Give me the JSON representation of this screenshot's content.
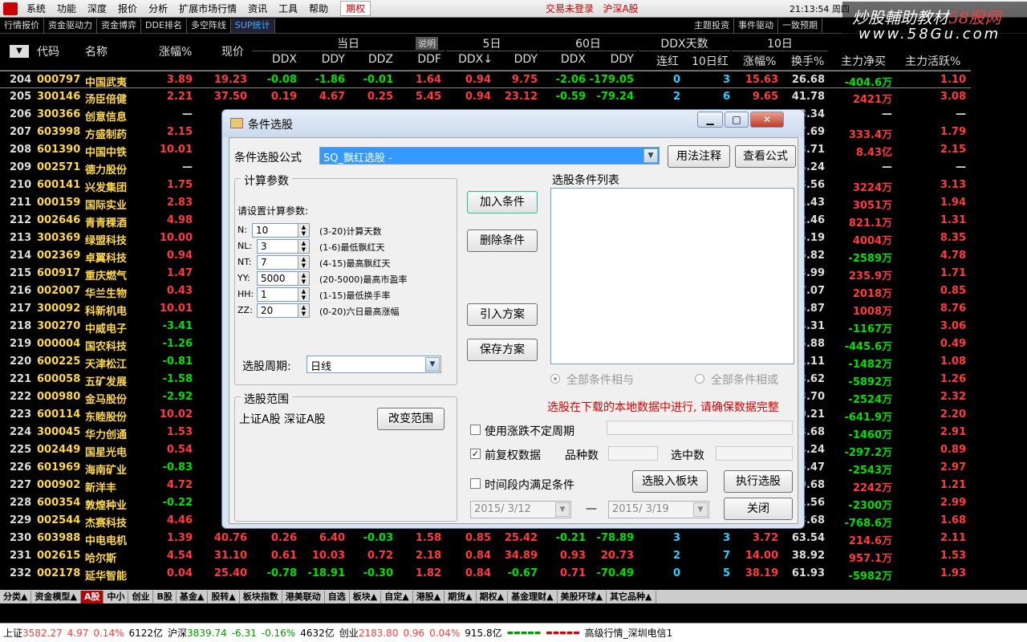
{
  "menu": {
    "items": [
      "系统",
      "功能",
      "深度",
      "报价",
      "分析",
      "扩展市场行情",
      "资讯",
      "工具",
      "帮助"
    ],
    "qiquan": "期权",
    "login": "交易未登录",
    "market": "沪深A股",
    "clock": "21:13:54 周四"
  },
  "tabs": {
    "left": [
      "行情报价",
      "资金驱动力",
      "资金博弈",
      "DDE排名",
      "多空阵线",
      "SUP统计"
    ],
    "active": "SUP统计",
    "right": [
      "主题投资",
      "事件驱动",
      "一致预期"
    ]
  },
  "watermark": {
    "line1a": "炒股輔助教材",
    "line1b": "58股网",
    "line2": "www.58Gu.com"
  },
  "table": {
    "groups": [
      "当日",
      "5日",
      "60日",
      "DDX天数",
      "10日"
    ],
    "shuoming": "说明",
    "headers": [
      "代码",
      "名称",
      "涨幅%",
      "现价",
      "DDX",
      "DDY",
      "DDZ",
      "DDF",
      "DDX↓",
      "DDY",
      "DDX",
      "DDY",
      "连红",
      "10日红",
      "涨幅%",
      "换手%",
      "主力净买",
      "主力活跃%"
    ],
    "rows": [
      [
        "204",
        "000797",
        "中国武夷",
        "3.89",
        "19.23",
        "-0.08",
        "-1.86",
        "-0.01",
        "1.64",
        "0.94",
        "9.75",
        "-2.06",
        "-179.05",
        "0",
        "3",
        "15.63",
        "26.68",
        "-404.6万",
        "1.10"
      ],
      [
        "205",
        "300146",
        "汤臣倍健",
        "2.21",
        "37.50",
        "0.19",
        "4.67",
        "0.25",
        "5.45",
        "0.94",
        "23.12",
        "-0.59",
        "-79.24",
        "2",
        "6",
        "9.65",
        "41.78",
        "2421万",
        "3.08"
      ],
      [
        "206",
        "300366",
        "创意信息",
        "—",
        "",
        "",
        "",
        "",
        "",
        "",
        "",
        "",
        "",
        "",
        "",
        "",
        "3.34",
        "—",
        "—"
      ],
      [
        "207",
        "603998",
        "方盛制药",
        "2.15",
        "",
        "",
        "",
        "",
        "",
        "",
        "",
        "",
        "",
        "",
        "",
        "",
        "7.69",
        "333.4万",
        "1.79"
      ],
      [
        "208",
        "601390",
        "中国中铁",
        "10.01",
        "",
        "",
        "",
        "",
        "",
        "",
        "",
        "",
        "",
        "",
        "",
        "",
        "3.71",
        "8.43亿",
        "2.15"
      ],
      [
        "209",
        "002571",
        "德力股份",
        "—",
        "",
        "",
        "",
        "",
        "",
        "",
        "",
        "",
        "",
        "",
        "",
        "",
        "4.24",
        "—",
        "—"
      ],
      [
        "210",
        "600141",
        "兴发集团",
        "1.75",
        "",
        "",
        "",
        "",
        "",
        "",
        "",
        "",
        "",
        "",
        "",
        "",
        "3.56",
        "3224万",
        "3.13"
      ],
      [
        "211",
        "000159",
        "国际实业",
        "2.83",
        "",
        "",
        "",
        "",
        "",
        "",
        "",
        "",
        "",
        "",
        "",
        "",
        "1.43",
        "3051万",
        "1.94"
      ],
      [
        "212",
        "002646",
        "青青稞酒",
        "4.98",
        "",
        "",
        "",
        "",
        "",
        "",
        "",
        "",
        "",
        "",
        "",
        "",
        "2.46",
        "821.1万",
        "1.31"
      ],
      [
        "213",
        "300369",
        "绿盟科技",
        "10.00",
        "",
        "",
        "",
        "",
        "",
        "",
        "",
        "",
        "",
        "",
        "",
        "",
        "5.19",
        "4004万",
        "8.35"
      ],
      [
        "214",
        "002369",
        "卓翼科技",
        "0.94",
        "",
        "",
        "",
        "",
        "",
        "",
        "",
        "",
        "",
        "",
        "",
        "",
        "6.82",
        "-2589万",
        "4.78"
      ],
      [
        "215",
        "600917",
        "重庆燃气",
        "1.47",
        "",
        "",
        "",
        "",
        "",
        "",
        "",
        "",
        "",
        "",
        "",
        "",
        "3.99",
        "235.9万",
        "1.71"
      ],
      [
        "216",
        "002007",
        "华兰生物",
        "0.43",
        "",
        "",
        "",
        "",
        "",
        "",
        "",
        "",
        "",
        "",
        "",
        "",
        "7.07",
        "2018万",
        "0.85"
      ],
      [
        "217",
        "300092",
        "科新机电",
        "10.01",
        "",
        "",
        "",
        "",
        "",
        "",
        "",
        "",
        "",
        "",
        "",
        "",
        "5.87",
        "1008万",
        "8.76"
      ],
      [
        "218",
        "300270",
        "中威电子",
        "-3.41",
        "",
        "",
        "",
        "",
        "",
        "",
        "",
        "",
        "",
        "",
        "",
        "",
        "4.31",
        "-1167万",
        "3.06"
      ],
      [
        "219",
        "000004",
        "国农科技",
        "-1.26",
        "",
        "",
        "",
        "",
        "",
        "",
        "",
        "",
        "",
        "",
        "",
        "",
        "5.88",
        "-445.6万",
        "0.49"
      ],
      [
        "220",
        "600225",
        "天津松江",
        "-0.81",
        "",
        "",
        "",
        "",
        "",
        "",
        "",
        "",
        "",
        "",
        "",
        "",
        "1.11",
        "-1482万",
        "1.08"
      ],
      [
        "221",
        "600058",
        "五矿发展",
        "-1.58",
        "",
        "",
        "",
        "",
        "",
        "",
        "",
        "",
        "",
        "",
        "",
        "",
        "3.62",
        "-5892万",
        "1.26"
      ],
      [
        "222",
        "000980",
        "金马股份",
        "-2.92",
        "",
        "",
        "",
        "",
        "",
        "",
        "",
        "",
        "",
        "",
        "",
        "",
        "3.70",
        "-2524万",
        "2.32"
      ],
      [
        "223",
        "600114",
        "东睦股份",
        "10.02",
        "",
        "",
        "",
        "",
        "",
        "",
        "",
        "",
        "",
        "",
        "",
        "",
        "0.21",
        "-641.9万",
        "2.20"
      ],
      [
        "224",
        "300045",
        "华力创通",
        "1.53",
        "",
        "",
        "",
        "",
        "",
        "",
        "",
        "",
        "",
        "",
        "",
        "",
        "3.68",
        "-1460万",
        "2.91"
      ],
      [
        "225",
        "002449",
        "国星光电",
        "0.54",
        "",
        "",
        "",
        "",
        "",
        "",
        "",
        "",
        "",
        "",
        "",
        "",
        "4.24",
        "-297.2万",
        "0.89"
      ],
      [
        "226",
        "601969",
        "海南矿业",
        "-0.83",
        "",
        "",
        "",
        "",
        "",
        "",
        "",
        "",
        "",
        "",
        "",
        "",
        "5.47",
        "-2543万",
        "2.97"
      ],
      [
        "227",
        "000902",
        "新洋丰",
        "4.72",
        "",
        "",
        "",
        "",
        "",
        "",
        "",
        "",
        "",
        "",
        "",
        "",
        "0.68",
        "2242万",
        "1.21"
      ],
      [
        "228",
        "600354",
        "敦煌种业",
        "-0.22",
        "",
        "",
        "",
        "",
        "",
        "",
        "",
        "",
        "",
        "",
        "",
        "",
        "1.56",
        "-2300万",
        "2.99"
      ],
      [
        "229",
        "002544",
        "杰赛科技",
        "4.46",
        "",
        "",
        "",
        "",
        "",
        "",
        "",
        "",
        "",
        "",
        "",
        "",
        "3.68",
        "-768.6万",
        "1.68"
      ],
      [
        "230",
        "603988",
        "中电电机",
        "1.39",
        "40.76",
        "0.26",
        "6.40",
        "-0.03",
        "1.58",
        "0.85",
        "25.42",
        "-0.21",
        "-78.89",
        "3",
        "3",
        "3.72",
        "63.54",
        "214.6万",
        "2.11"
      ],
      [
        "231",
        "002615",
        "哈尔斯",
        "4.54",
        "31.10",
        "0.61",
        "10.03",
        "0.72",
        "2.18",
        "0.84",
        "34.89",
        "0.93",
        "20.73",
        "2",
        "7",
        "14.00",
        "38.92",
        "957.1万",
        "1.53"
      ],
      [
        "232",
        "002178",
        "延华智能",
        "0.04",
        "25.40",
        "-0.78",
        "-18.91",
        "-0.30",
        "1.82",
        "0.84",
        "-0.67",
        "0.71",
        "-70.49",
        "0",
        "5",
        "38.19",
        "61.93",
        "-5982万",
        "1.93"
      ]
    ]
  },
  "bottom_tabs": [
    "分类▲",
    "资金模型▲",
    "A股",
    "中小",
    "创业",
    "B股",
    "基金▲",
    "股转▲",
    "板块指数",
    "港美联动",
    "自选",
    "板块▲",
    "自定▲",
    "港股▲",
    "期货▲",
    "期权▲",
    "基金理财▲",
    "美股环球▲",
    "其它品种▲"
  ],
  "status": {
    "sh": "上证",
    "sh_v": "3582.27",
    "sh_c": "4.97",
    "sh_p": "0.14%",
    "sh_a": "6122亿",
    "hs": "沪深",
    "hs_v": "3839.74",
    "hs_c": "-6.31",
    "hs_p": "-0.16%",
    "hs_a": "4632亿",
    "cy": "创业",
    "cy_v": "2183.80",
    "cy_c": "0.96",
    "cy_p": "0.04%",
    "cy_a": "915.8亿",
    "src": "高级行情_深圳电信1"
  },
  "dialog": {
    "title": "条件选股",
    "formula_label": "条件选股公式",
    "formula_value": "SQ_飘红选股  -",
    "usage_btn": "用法注释",
    "view_btn": "查看公式",
    "params_title": "计算参数",
    "params_prompt": "请设置计算参数:",
    "params": [
      {
        "name": "N:",
        "value": "10",
        "desc": "(3-20)计算天数"
      },
      {
        "name": "NL:",
        "value": "3",
        "desc": "(1-6)最低飘红天"
      },
      {
        "name": "NT:",
        "value": "7",
        "desc": "(4-15)最高飘红天"
      },
      {
        "name": "YY:",
        "value": "5000",
        "desc": "(20-5000)最高市盈率"
      },
      {
        "name": "HH:",
        "value": "1",
        "desc": "(1-15)最低换手率"
      },
      {
        "name": "ZZ:",
        "value": "20",
        "desc": "(0-20)六日最高涨幅"
      }
    ],
    "period_label": "选股周期:",
    "period_value": "日线",
    "add_btn": "加入条件",
    "del_btn": "删除条件",
    "import_btn": "引入方案",
    "save_btn": "保存方案",
    "list_title": "选股条件列表",
    "radio_and": "全部条件相与",
    "radio_or": "全部条件相或",
    "warning": "选股在下载的本地数据中进行, 请确保数据完整",
    "range_title": "选股范围",
    "range_value": "上证A股  深证A股",
    "range_btn": "改变范围",
    "chk_period": "使用涨跌不定周期",
    "chk_fq": "前复权数据",
    "count_label": "品种数",
    "selected_label": "选中数",
    "chk_time": "时间段内满足条件",
    "to_block_btn": "选股入板块",
    "run_btn": "执行选股",
    "close_btn": "关闭",
    "date_from": "2015/ 3/12",
    "date_sep": "—",
    "date_to": "2015/ 3/19"
  }
}
